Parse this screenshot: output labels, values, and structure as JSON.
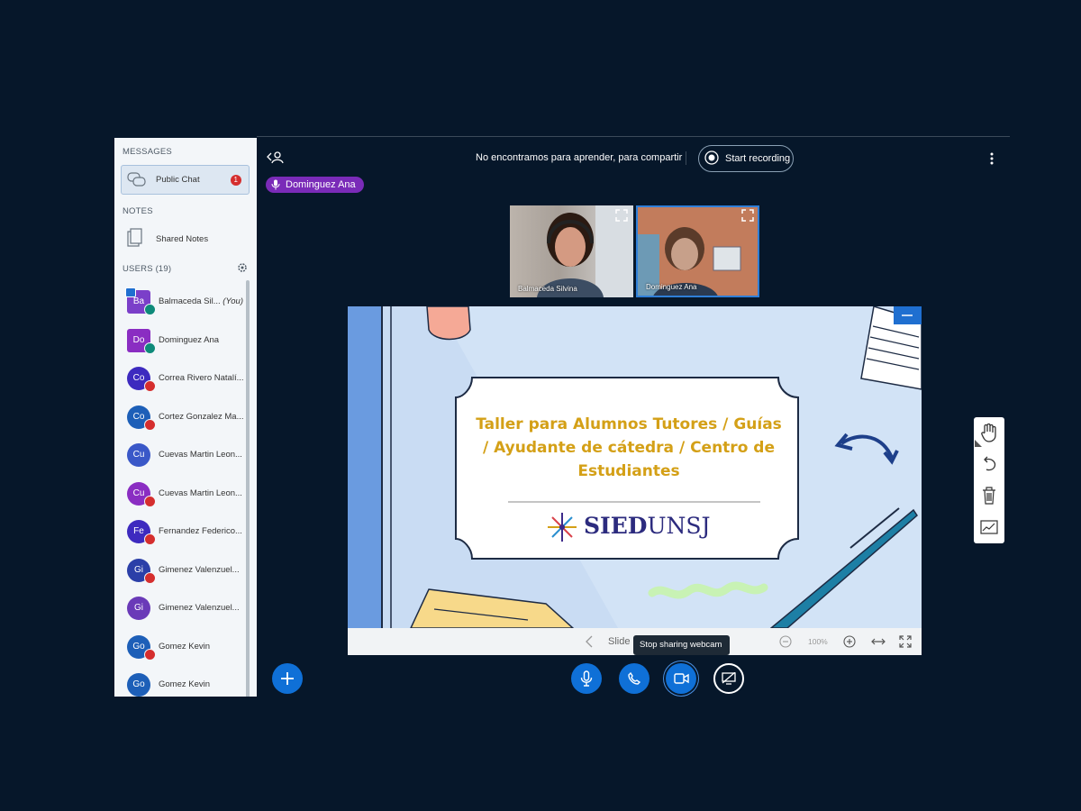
{
  "sidebar": {
    "messages_label": "MESSAGES",
    "public_chat_label": "Public Chat",
    "public_chat_unread": "1",
    "notes_label": "NOTES",
    "shared_notes_label": "Shared Notes",
    "users_label": "USERS (19)",
    "users": [
      {
        "initials": "Ba",
        "name": "Balmaceda Sil...",
        "you": "(You)",
        "color": "#7b3fc9",
        "status": "mic"
      },
      {
        "initials": "Do",
        "name": "Dominguez Ana",
        "you": "",
        "color": "#8a2dc2",
        "status": "mic"
      },
      {
        "initials": "Co",
        "name": "Correa Rivero Natalí...",
        "you": "",
        "color": "#3d2abf",
        "status": "muted"
      },
      {
        "initials": "Co",
        "name": "Cortez Gonzalez Ma...",
        "you": "",
        "color": "#1d5fb8",
        "status": "muted"
      },
      {
        "initials": "Cu",
        "name": "Cuevas Martin Leon...",
        "you": "",
        "color": "#3a58c8",
        "status": "none"
      },
      {
        "initials": "Cu",
        "name": "Cuevas Martin Leon...",
        "you": "",
        "color": "#8a2dc2",
        "status": "muted"
      },
      {
        "initials": "Fe",
        "name": "Fernandez Federico...",
        "you": "",
        "color": "#3d2abf",
        "status": "muted"
      },
      {
        "initials": "Gi",
        "name": "Gimenez Valenzuel...",
        "you": "",
        "color": "#2b3fa8",
        "status": "muted"
      },
      {
        "initials": "Gi",
        "name": "Gimenez Valenzuel...",
        "you": "",
        "color": "#6a3ab8",
        "status": "none"
      },
      {
        "initials": "Go",
        "name": "Gomez Kevin",
        "you": "",
        "color": "#1d5fb8",
        "status": "muted"
      },
      {
        "initials": "Go",
        "name": "Gomez Kevin",
        "you": "",
        "color": "#1d5fb8",
        "status": "none"
      }
    ]
  },
  "topbar": {
    "meeting_title": "No encontramos para aprender, para compartir",
    "record_label": "Start recording"
  },
  "talking_indicator": "Dominguez Ana",
  "webcams": [
    {
      "name": "Balmaceda Silvina"
    },
    {
      "name": "Dominguez Ana"
    }
  ],
  "slide": {
    "title_lines": [
      "Taller para Alumnos Tutores / Guías",
      "/ Ayudante de cátedra / Centro de",
      "Estudiantes"
    ],
    "logo_text_1": "SIED",
    "logo_text_2": "UNSJ",
    "nav_label": "Slide",
    "zoom": "100%"
  },
  "tooltip": "Stop sharing webcam",
  "colors": {
    "accent": "#0f70d7",
    "background": "#06172a",
    "talker": "#7a2bb8",
    "slide_title": "#d4a017"
  },
  "icons": [
    "user-list-toggle-icon",
    "record-icon",
    "more-vertical-icon",
    "chat-icon",
    "notes-icon",
    "gear-icon",
    "plus-icon",
    "microphone-icon",
    "phone-icon",
    "camera-icon",
    "screenshare-icon",
    "hand-icon",
    "undo-icon",
    "trash-icon",
    "chart-icon",
    "fullscreen-icon",
    "minimize-icon"
  ]
}
